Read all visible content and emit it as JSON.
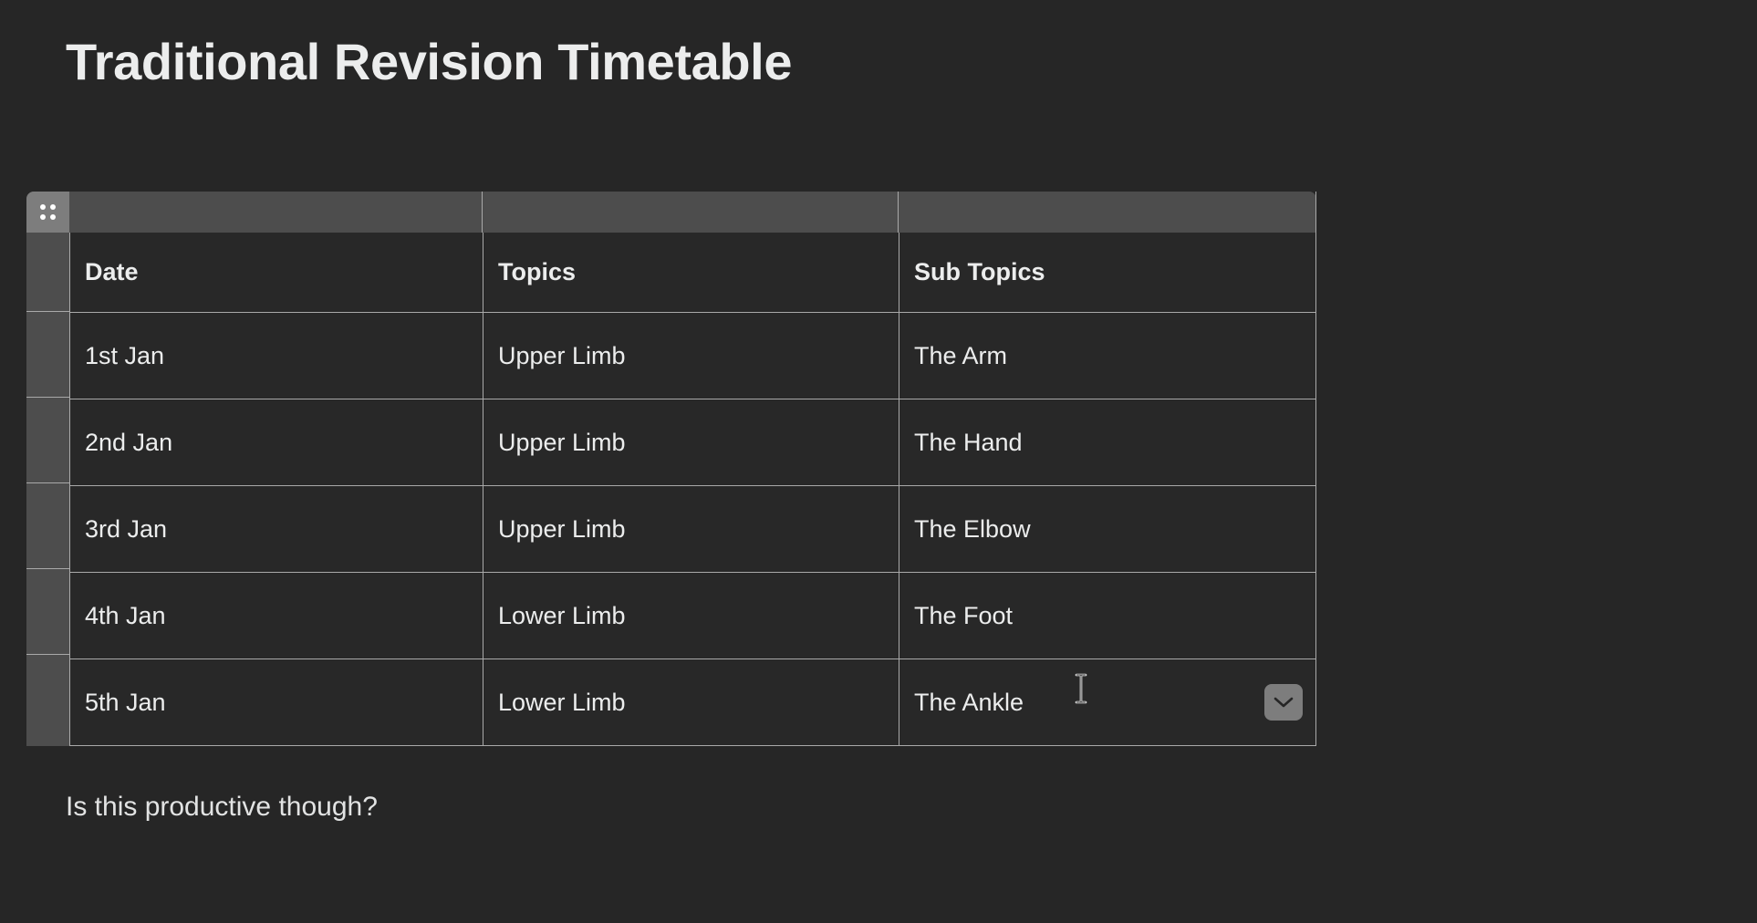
{
  "page": {
    "title": "Traditional Revision Timetable",
    "caption": "Is this productive though?",
    "background_color": "#262626",
    "text_color": "#eceded"
  },
  "table": {
    "drag_handle_icon": "drag-dots-icon",
    "border_color": "#a9a9a9",
    "strip_color": "#4d4d4d",
    "handle_color": "#7d7d7d",
    "cell_background": "#282828",
    "columns": [
      "Date",
      "Topics",
      "Sub Topics"
    ],
    "rows": [
      {
        "date": "1st Jan",
        "topic": "Upper Limb",
        "subtopic": "The Arm"
      },
      {
        "date": "2nd Jan",
        "topic": "Upper Limb",
        "subtopic": "The Hand"
      },
      {
        "date": "3rd Jan",
        "topic": "Upper Limb",
        "subtopic": "The Elbow"
      },
      {
        "date": "4th Jan",
        "topic": "Lower Limb",
        "subtopic": "The Foot"
      },
      {
        "date": "5th Jan",
        "topic": "Lower Limb",
        "subtopic": "The Ankle"
      }
    ],
    "expand_button_icon": "chevron-down-icon"
  },
  "cursor": {
    "type": "text-ibeam-cursor"
  }
}
